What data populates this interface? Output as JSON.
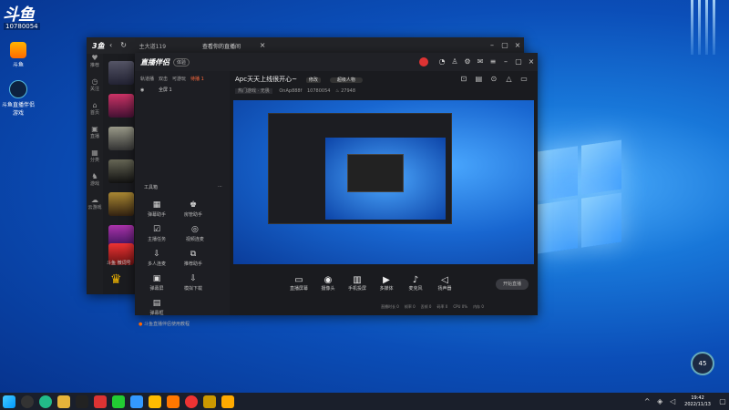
{
  "desktop": {
    "brand": "斗鱼",
    "brand_id": "10780054",
    "icons": [
      {
        "label": "斗鱼"
      },
      {
        "label": "斗鱼直播伴侣游戏"
      }
    ]
  },
  "back_window": {
    "title": "主大道119",
    "tab": "查看你的直播间",
    "rail": [
      {
        "label": "推荐"
      },
      {
        "label": "关注"
      },
      {
        "label": "首页"
      },
      {
        "label": "直播"
      },
      {
        "label": "分类"
      },
      {
        "label": "游戏"
      },
      {
        "label": "云游戏"
      }
    ],
    "footer": "斗鱼 微词号"
  },
  "main_window": {
    "logo": "直播伴侣",
    "badge": "体验",
    "tabs": [
      "轨道播",
      "双击",
      "可游玩",
      "待播 1"
    ],
    "scene": "全屏 1",
    "stream_title": "Apc天天上线很开心~",
    "edit_label": "修改",
    "pill": "超级人物",
    "category": "热门游戏 · 无畏",
    "room": "OnAp888f",
    "room_id": "10780054",
    "heat": "27948",
    "toolbox_label": "工具箱",
    "tools": [
      {
        "icon": "▦",
        "label": "弹幕助手"
      },
      {
        "icon": "♚",
        "label": "房管助手"
      },
      {
        "icon": "☑",
        "label": "主播任务"
      },
      {
        "icon": "◎",
        "label": "视频连麦"
      },
      {
        "icon": "⇩",
        "label": "多人连麦"
      },
      {
        "icon": "⧉",
        "label": "推荐助手"
      },
      {
        "icon": "▣",
        "label": "弹幕屏"
      },
      {
        "icon": "⇩",
        "label": "模拟下载"
      },
      {
        "icon": "▤",
        "label": "弹幕框"
      }
    ],
    "notice": "斗鱼直播伴侣使用教程",
    "bottom_tools": [
      {
        "icon": "▭",
        "label": "直播屏幕"
      },
      {
        "icon": "◉",
        "label": "摄像头"
      },
      {
        "icon": "▥",
        "label": "手机投屏"
      },
      {
        "icon": "▶",
        "label": "多媒体"
      },
      {
        "icon": "♪",
        "label": "麦克风"
      },
      {
        "icon": "◁",
        "label": "扬声器"
      }
    ],
    "start_btn": "开始直播",
    "status": [
      "直播时长 0",
      "帧率 0",
      "丢帧 0",
      "码率 0",
      "CPU 0%",
      "内存 0"
    ]
  },
  "taskbar": {
    "time": "19:42",
    "date": "2022/11/13"
  },
  "desktop_badge": "45"
}
